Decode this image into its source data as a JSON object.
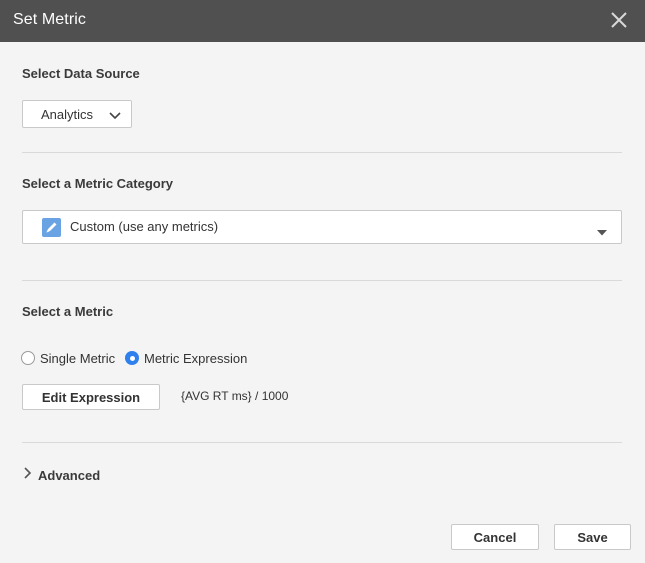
{
  "dialog": {
    "title": "Set Metric",
    "close_icon": "close-icon"
  },
  "data_source": {
    "heading": "Select Data Source",
    "selected": "Analytics",
    "dropdown_icon": "chevron-down-icon"
  },
  "category": {
    "heading": "Select a Metric Category",
    "selected": "Custom (use any metrics)",
    "icon": "pencil-icon",
    "dropdown_icon": "caret-down-icon"
  },
  "metric": {
    "heading": "Select a Metric",
    "options": [
      {
        "label": "Single Metric",
        "checked": false
      },
      {
        "label": "Metric Expression",
        "checked": true
      }
    ],
    "edit_button": "Edit Expression",
    "expression": "{AVG RT ms} / 1000"
  },
  "advanced": {
    "label": "Advanced",
    "icon": "chevron-right-icon"
  },
  "footer": {
    "cancel": "Cancel",
    "save": "Save"
  },
  "colors": {
    "header_bg": "#505050",
    "accent": "#2f80ed",
    "page_bg": "#f4f4f4"
  }
}
